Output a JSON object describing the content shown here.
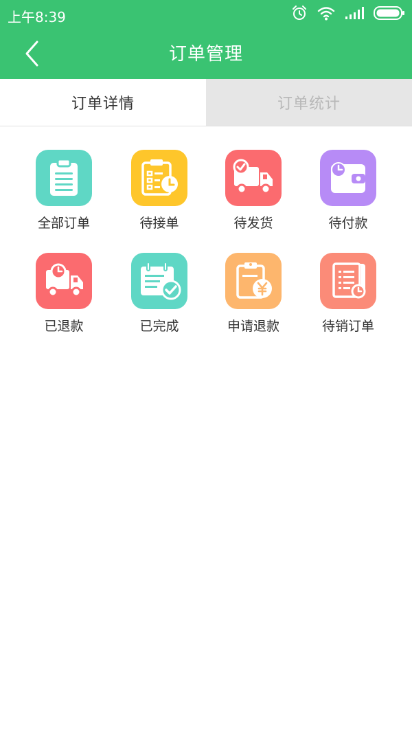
{
  "status_bar": {
    "time": "上午8:39",
    "icons": [
      "alarm-icon",
      "wifi-icon",
      "signal-icon",
      "battery-icon"
    ]
  },
  "header": {
    "title": "订单管理",
    "back_icon": "chevron-left-icon",
    "background": "#3ac372"
  },
  "tabs": [
    {
      "label": "订单详情",
      "active": true
    },
    {
      "label": "订单统计",
      "active": false
    }
  ],
  "grid": {
    "items": [
      {
        "label": "全部订单",
        "icon": "clipboard-icon",
        "color": "#5fd7c5"
      },
      {
        "label": "待接单",
        "icon": "clipboard-clock-icon",
        "color": "#fec62b"
      },
      {
        "label": "待发货",
        "icon": "truck-check-icon",
        "color": "#fb6b6f"
      },
      {
        "label": "待付款",
        "icon": "wallet-clock-icon",
        "color": "#b78bf6"
      },
      {
        "label": "已退款",
        "icon": "truck-clock-icon",
        "color": "#fb6b6f"
      },
      {
        "label": "已完成",
        "icon": "calendar-check-icon",
        "color": "#5fd7c5"
      },
      {
        "label": "申请退款",
        "icon": "clipboard-yen-icon",
        "color": "#fdb66d"
      },
      {
        "label": "待销订单",
        "icon": "receipt-clock-icon",
        "color": "#fb8b78"
      }
    ]
  }
}
